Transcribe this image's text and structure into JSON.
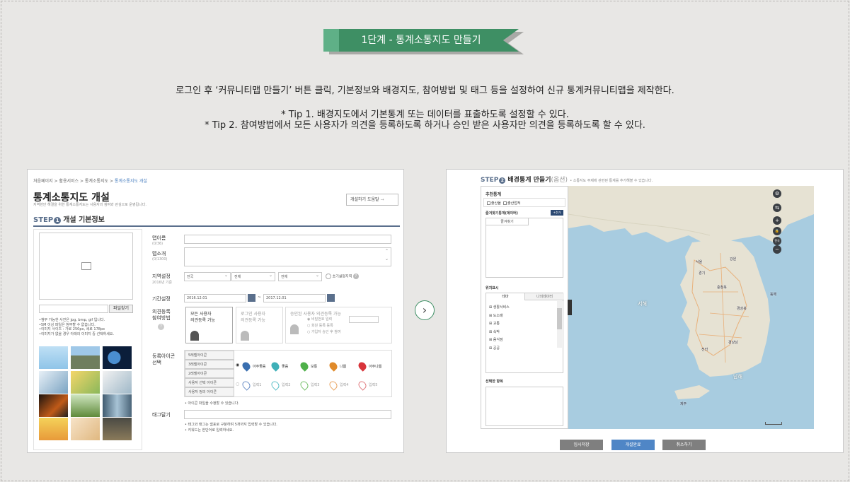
{
  "banner": {
    "title": "1단계 - 통계소통지도 만들기"
  },
  "description": {
    "line1": "로그인 후 ‘커뮤니티맵 만들기’ 버튼 클릭, 기본정보와 배경지도, 참여방법 및 태그 등을 설정하여 신규 통계커뮤니티맵을 제작한다.",
    "tip1": "* Tip 1. 배경지도에서 기본통계 또는 데이터를 표출하도록 설정할 수 있다.",
    "tip2": "* Tip 2. 참여방법에서 모든 사용자가 의견을 등록하도록 하거나 승인 받은 사용자만 의견을 등록하도록 할 수 있다."
  },
  "left": {
    "breadcrumb": [
      "처음페이지",
      "활용서비스",
      "통계소통지도",
      "통계소통지도 개설"
    ],
    "page_title": "통계소통지도 개설",
    "page_subtitle": "지역현안 해결을 위한 통계소통지도는 사용자의 참여와 관심으로 운영됩니다.",
    "help_button": "개설하기 도움말",
    "step_label": "STEP",
    "step_number": "1",
    "step_title": "개설 기본정보",
    "file_button": "파일찾기",
    "upload_notes": [
      "•첨부 가능한 사진은 jpg, bmp, gif 입니다.",
      "•5M 이상 파일은 첨부할 수 없습니다.",
      "•이미지 사이즈 : 가로 250px, 세로 178px",
      "•이미지가 없을 경우 아래의 이미지 중 선택하세요."
    ],
    "fields": {
      "name": {
        "label": "맵이름",
        "sub": "(0/36)"
      },
      "intro": {
        "label": "맵소개",
        "sub": "(0/1300)"
      },
      "region": {
        "label": "지역설정",
        "sub": "2016년 기준",
        "sel1": "전국",
        "sel2": "전체",
        "sel3": "전체",
        "reset": "초기설정지역"
      },
      "period": {
        "label": "기간설정",
        "start": "2016.12.01",
        "tilde": "~",
        "end": "2017.12.01"
      },
      "participation": {
        "label1": "의견등록",
        "label2": "참여방법",
        "opt1_l1": "모든 사용자",
        "opt1_l2": "의견등록 가능",
        "opt2_l1": "로그인 사용자",
        "opt2_l2": "의견등록 가능",
        "opt3_l1": "승인된 사용자 의견등록 가능",
        "opt3_r1": "비밀번호 입력",
        "opt3_r2": "회원 등록 등록",
        "opt3_r3": "가입자 승인 후 참여"
      },
      "icons": {
        "label1": "등록아이콘",
        "label2": "선택",
        "rows": [
          "5레벨아이콘",
          "3레벨아이콘",
          "2레벨아이콘",
          "사용자 선택 아이콘",
          "사용자 정의 아이콘"
        ],
        "level_names": [
          "아주좋음",
          "좋음",
          "보통",
          "나쁨",
          "아주나쁨"
        ],
        "custom_names": [
          "입력1",
          "입력2",
          "입력3",
          "입력4",
          "입력5"
        ],
        "note": "• 아이콘 파일을 수정할 수 있습니다."
      },
      "tags": {
        "label": "태그달기",
        "note1": "• 태그와 태그는 쉼표로 구분하며 5개까지 입력할 수 있습니다.",
        "note2": "• 키워드는 한단어로 입력하세요."
      }
    }
  },
  "right": {
    "step_label": "STEP",
    "step_number": "2",
    "step_title": "배경통계 만들기",
    "step_optional": "(옵션)",
    "step_note": "• 소통지도 주제에 관련된 통계를 추가해볼 수 있습니다.",
    "recommend_label": "추천통계",
    "recommend_opts": [
      "출산율",
      "출산업적"
    ],
    "favorite_label": "즐겨찾기통계(데이터)",
    "add_button": "+추가",
    "favorite_tab": "즐겨찾기",
    "location_label": "위치표시",
    "location_tabs": [
      "테마",
      "나의데이터"
    ],
    "location_items": [
      "생활서비스",
      "도소매",
      "교통",
      "숙박",
      "음식점",
      "공공"
    ],
    "selected_label": "선택한 항목",
    "map_labels": {
      "sea_west": "서해",
      "sea_south": "남해",
      "sea_east": "동해",
      "seoul": "서울",
      "gangwon": "강원",
      "gyeongbuk": "경상북",
      "gyeongnam": "경상남",
      "chungbuk": "충청북",
      "gyeonggi": "경기",
      "jeolla": "전라",
      "jeju": "제주"
    },
    "map_controls": [
      "⚙",
      "⇆",
      "+",
      "🔒",
      "전국",
      "−"
    ],
    "buttons": {
      "temp_save": "임시저장",
      "create": "개설완료",
      "cancel": "취소하기"
    }
  },
  "colors": {
    "banner_green": "#3e8f64",
    "banner_light": "#5fb087",
    "step_blue": "#5a6f8c",
    "create_button": "#4f86c6",
    "gray_button": "#7f7f7f",
    "map_sea": "#a8cce0",
    "map_land": "#e6e2d3"
  },
  "nav": {
    "next_icon": "chevron-right-icon"
  }
}
